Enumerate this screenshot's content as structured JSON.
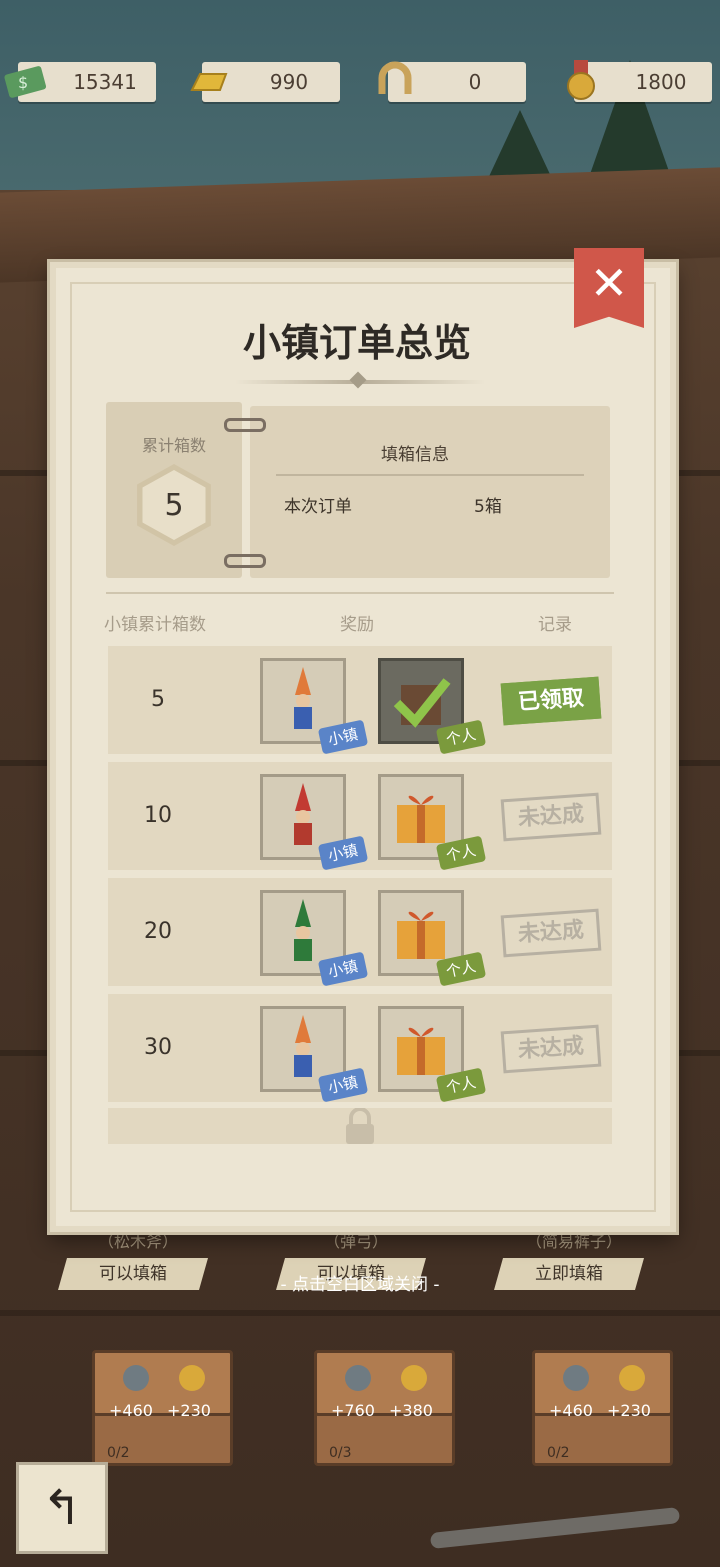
{
  "resources": {
    "money": "15341",
    "gold": "990",
    "horseshoe": "0",
    "medal": "1800"
  },
  "modal": {
    "title": "小镇订单总览",
    "close_icon": "close-icon",
    "total_boxes_label": "累计箱数",
    "total_boxes_value": "5",
    "info_title": "填箱信息",
    "order_label": "本次订单",
    "order_value": "5箱",
    "headers": {
      "count": "小镇累计箱数",
      "reward": "奖励",
      "record": "记录"
    },
    "rows": [
      {
        "count": "5",
        "tag_town": "小镇",
        "tag_personal": "个人",
        "status": "已领取"
      },
      {
        "count": "10",
        "tag_town": "小镇",
        "tag_personal": "个人",
        "status": "未达成"
      },
      {
        "count": "20",
        "tag_town": "小镇",
        "tag_personal": "个人",
        "status": "未达成"
      },
      {
        "count": "30",
        "tag_town": "小镇",
        "tag_personal": "个人",
        "status": "未达成"
      }
    ]
  },
  "hint": "- 点击空白区域关闭 -",
  "bottom": {
    "slots": [
      {
        "label": "（松木斧）",
        "button": "可以填箱",
        "coins": "+460",
        "medals": "+230",
        "count": "0/2"
      },
      {
        "label": "（弹弓）",
        "button": "可以填箱",
        "coins": "+760",
        "medals": "+380",
        "count": "0/3"
      },
      {
        "label": "（简易裤子）",
        "button": "立即填箱",
        "coins": "+460",
        "medals": "+230",
        "count": "0/2"
      }
    ]
  },
  "colors": {
    "close_red": "#d0574a",
    "town_tag": "#5a84c8",
    "personal_tag": "#7b9a3c",
    "claimed_green": "#7aa246"
  }
}
